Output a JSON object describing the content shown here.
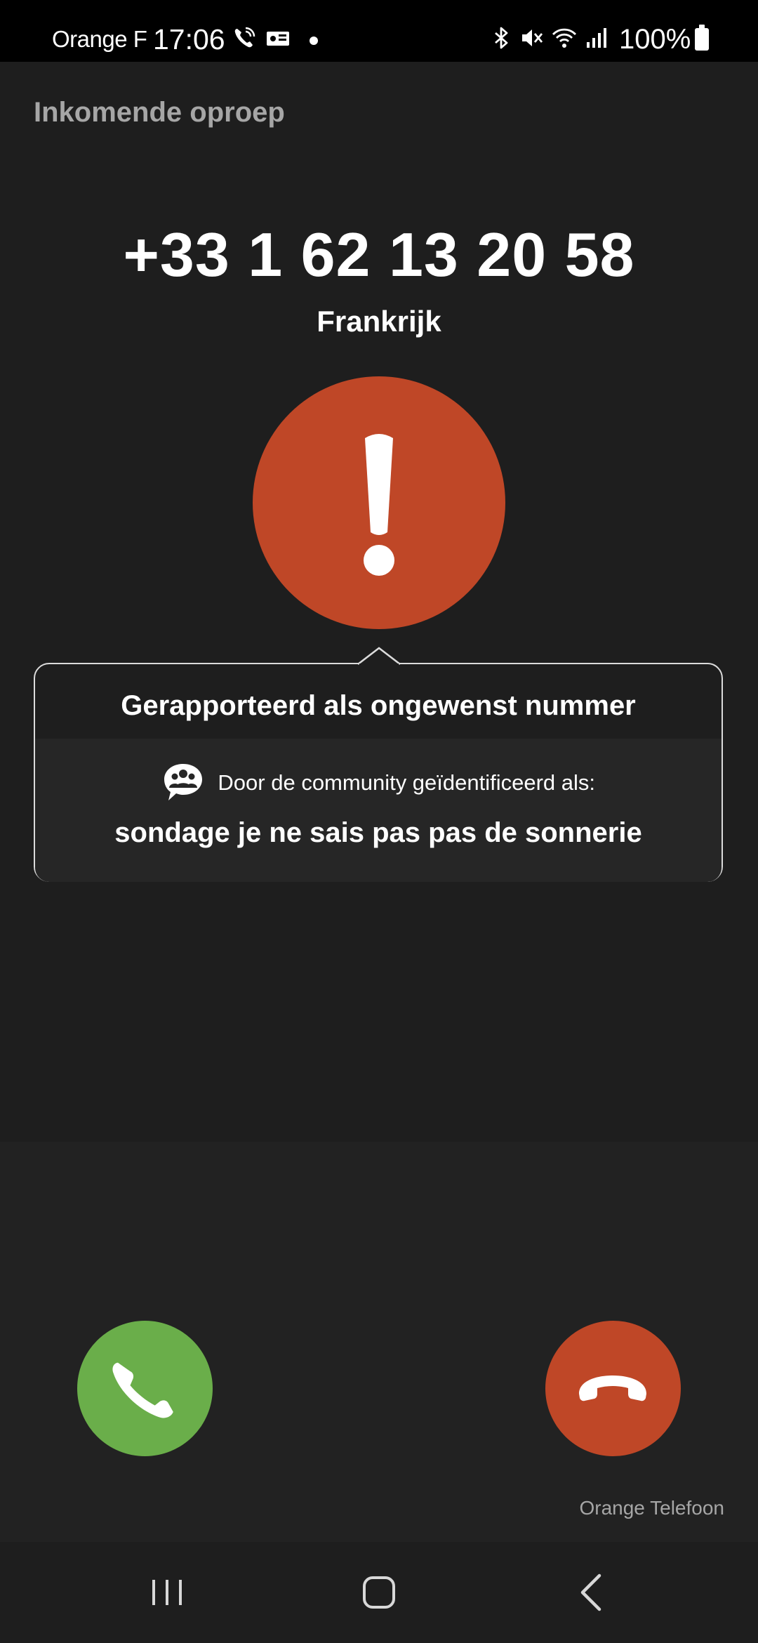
{
  "status_bar": {
    "carrier": "Orange F",
    "time": "17:06",
    "battery": "100%",
    "icons": [
      "wifi-calling-icon",
      "voicemail-icon",
      "notification-dot",
      "bluetooth-icon",
      "mute-icon",
      "wifi-icon",
      "signal-icon",
      "battery-icon"
    ]
  },
  "header": {
    "title": "Inkomende oproep"
  },
  "caller": {
    "number": "+33 1 62 13 20 58",
    "country": "Frankrijk",
    "warning_icon": "exclamation-icon"
  },
  "info_card": {
    "title": "Gerapporteerd als ongewenst nummer",
    "community_label": "Door de community geïdentificeerd als:",
    "identified_name": "sondage je ne sais pas pas de sonnerie",
    "icon": "community-icon"
  },
  "actions": {
    "accept_icon": "phone-icon",
    "decline_icon": "hang-up-icon",
    "brand": "Orange Telefoon"
  },
  "colors": {
    "accept": "#6aae4a",
    "decline": "#bf4727",
    "warning": "#bf4727",
    "background": "#1e1e1e"
  },
  "nav_bar": {
    "items": [
      "recent-apps-icon",
      "home-icon",
      "back-icon"
    ]
  }
}
